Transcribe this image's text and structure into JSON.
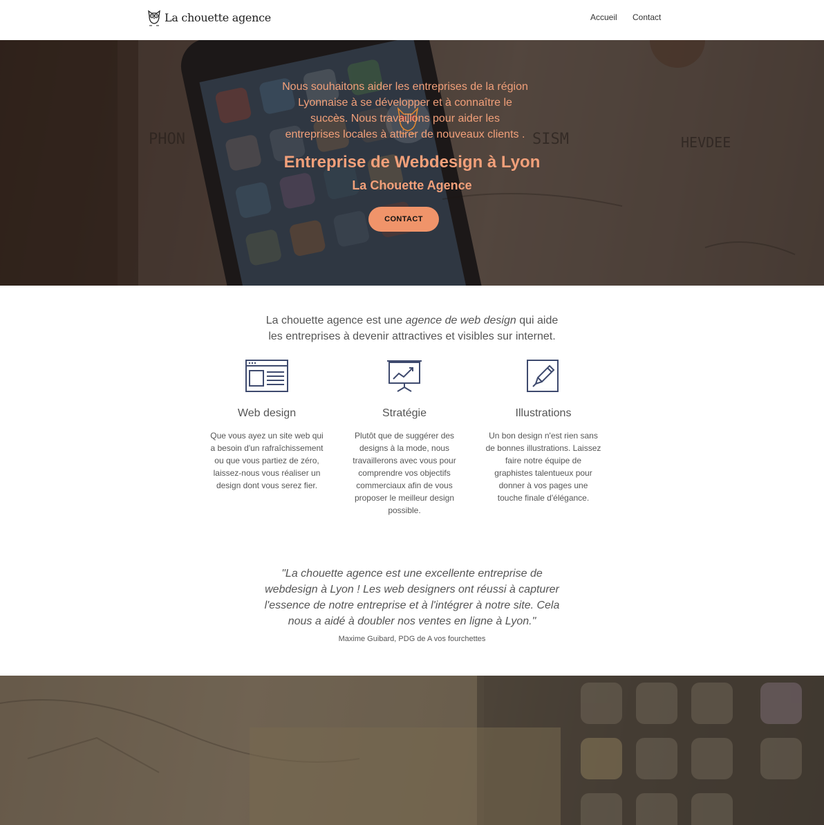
{
  "nav": {
    "brand": "La chouette agence",
    "links": [
      "Accueil",
      "Contact"
    ]
  },
  "hero": {
    "title": "Entreprise de Webdesign à Lyon",
    "subtitle": "La Chouette Agence",
    "button": "CONTACT",
    "accent": "#f2a07a",
    "button_color": "#f0946a"
  },
  "intro": {
    "before": "La chouette agence est une ",
    "emphasis": "agence de web design",
    "after_line1": " qui aide",
    "line2": "les entreprises à devenir attractives et visibles sur internet."
  },
  "features": [
    {
      "icon": "web-design-icon",
      "title": "Web design",
      "lines": [
        "Que vous ayez un site web qui",
        "a besoin d'un rafraîchissement",
        "ou que vous partiez de zéro,",
        "laissez-nous vous réaliser un",
        "design dont vous serez fier."
      ]
    },
    {
      "icon": "strategy-chart-icon",
      "title": "Stratégie",
      "lines": [
        "Plutôt que de suggérer des",
        "designs à la mode, nous",
        "travaillerons avec vous pour",
        "comprendre vos objectifs",
        "commerciaux afin de vous",
        "proposer le meilleur design",
        "possible."
      ]
    },
    {
      "icon": "pencil-edit-icon",
      "title": "Illustrations",
      "lines": [
        "Un bon design n'est rien sans",
        "de bonnes illustrations. Laissez",
        "faire notre équipe de",
        "graphistes talentueux pour",
        "donner à vos pages une",
        "touche finale d'élégance."
      ]
    }
  ],
  "quote": {
    "lines": [
      "\"La chouette agence est une excellente entreprise de",
      "webdesign à Lyon ! Les web designers ont réussi à capturer",
      "l'essence de notre entreprise et à l'intégrer à notre site. Cela",
      "nous a aidé à doubler nos ventes en ligne à Lyon.\""
    ],
    "author": "Maxime Guibard, PDG de A vos fourchettes"
  },
  "bottom": {
    "lines": [
      "Nous souhaitons aider les entreprises de la région",
      "Lyonnaise à se développer et à connaître le",
      "succès. Nous travaillons pour aider les",
      "entreprises locales à attirer de nouveaux clients ."
    ]
  }
}
